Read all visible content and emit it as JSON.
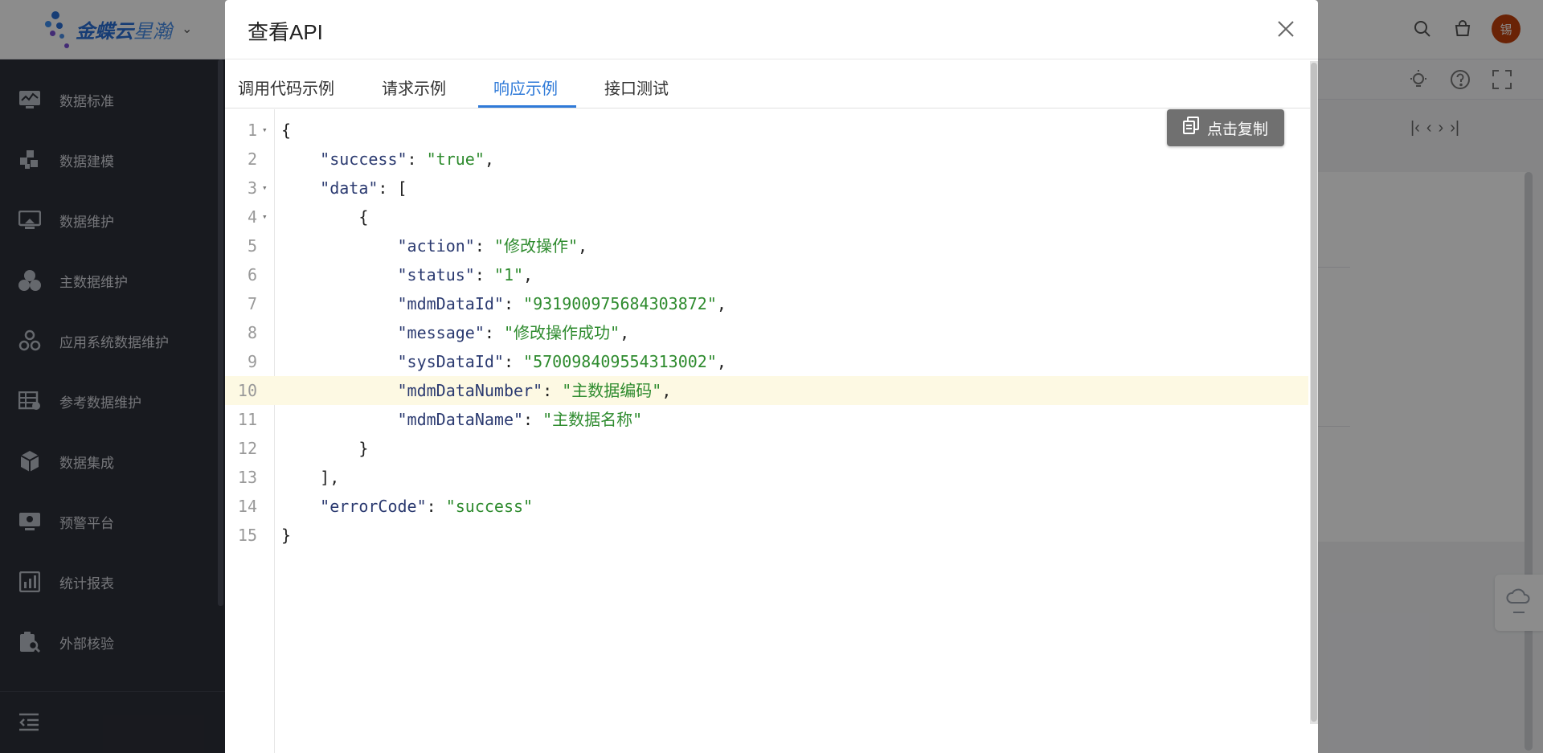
{
  "app": {
    "logo_brand": "金蝶云",
    "logo_product": "星瀚",
    "avatar_text": "锡"
  },
  "sidebar": {
    "items": [
      {
        "label": "数据标准",
        "icon": "chart-monitor-icon"
      },
      {
        "label": "数据建模",
        "icon": "blocks-icon"
      },
      {
        "label": "数据维护",
        "icon": "screen-icon"
      },
      {
        "label": "主数据维护",
        "icon": "cluster-icon"
      },
      {
        "label": "应用系统数据维护",
        "icon": "network-icon"
      },
      {
        "label": "参考数据维护",
        "icon": "table-icon"
      },
      {
        "label": "数据集成",
        "icon": "cube-icon"
      },
      {
        "label": "预警平台",
        "icon": "alert-monitor-icon"
      },
      {
        "label": "统计报表",
        "icon": "report-icon"
      },
      {
        "label": "外部核验",
        "icon": "clipboard-search-icon"
      }
    ]
  },
  "modal": {
    "title": "查看API",
    "tabs": [
      {
        "label": "调用代码示例",
        "active": false
      },
      {
        "label": "请求示例",
        "active": false
      },
      {
        "label": "响应示例",
        "active": true
      },
      {
        "label": "接口测试",
        "active": false
      }
    ],
    "copy_button": "点击复制",
    "highlighted_line": 10,
    "code_lines": [
      {
        "n": "1",
        "fold": true,
        "text": "{"
      },
      {
        "n": "2",
        "fold": false,
        "text": "    \"success\": \"true\","
      },
      {
        "n": "3",
        "fold": true,
        "text": "    \"data\": ["
      },
      {
        "n": "4",
        "fold": true,
        "text": "        {"
      },
      {
        "n": "5",
        "fold": false,
        "text": "            \"action\": \"修改操作\","
      },
      {
        "n": "6",
        "fold": false,
        "text": "            \"status\": \"1\","
      },
      {
        "n": "7",
        "fold": false,
        "text": "            \"mdmDataId\": \"931900975684303872\","
      },
      {
        "n": "8",
        "fold": false,
        "text": "            \"message\": \"修改操作成功\","
      },
      {
        "n": "9",
        "fold": false,
        "text": "            \"sysDataId\": \"570098409554313002\","
      },
      {
        "n": "10",
        "fold": false,
        "text": "            \"mdmDataNumber\": \"主数据编码\","
      },
      {
        "n": "11",
        "fold": false,
        "text": "            \"mdmDataName\": \"主数据名称\""
      },
      {
        "n": "12",
        "fold": false,
        "text": "        }"
      },
      {
        "n": "13",
        "fold": false,
        "text": "    ],"
      },
      {
        "n": "14",
        "fold": false,
        "text": "    \"errorCode\": \"success\""
      },
      {
        "n": "15",
        "fold": false,
        "text": "}"
      }
    ]
  },
  "colors": {
    "accent": "#2f7ad8",
    "sidebar_bg": "#2d3039",
    "string": "#2e8b2e",
    "key": "#2b3a70",
    "highlight": "#fdf9e3",
    "copy_button": "#707070"
  }
}
